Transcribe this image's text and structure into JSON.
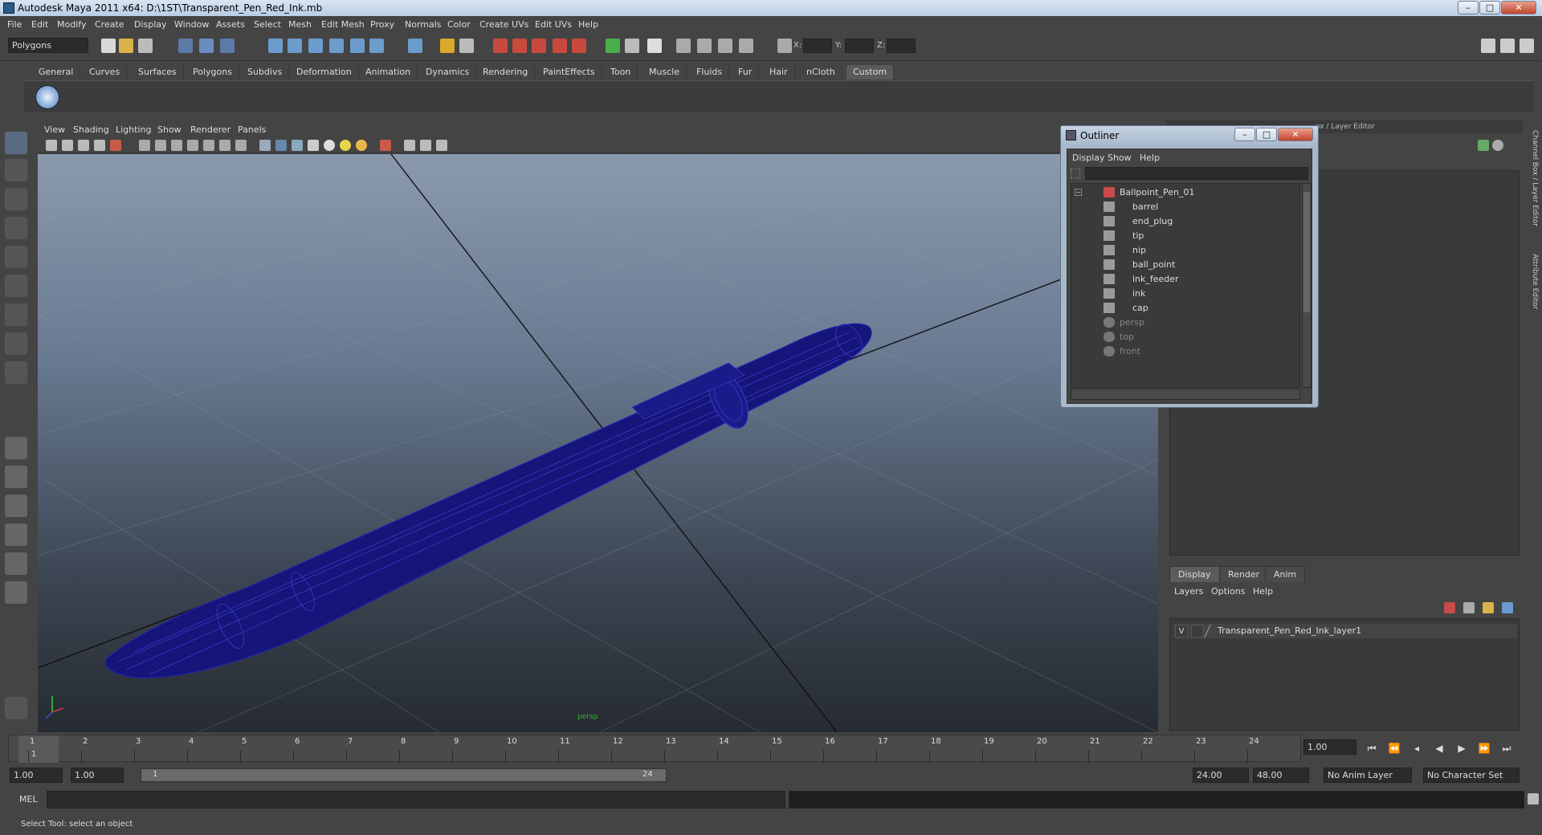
{
  "app": {
    "title": "Autodesk Maya 2011 x64: D:\\1ST\\Transparent_Pen_Red_Ink.mb",
    "win_buttons": [
      "–",
      "□",
      "✕"
    ]
  },
  "menubar": [
    "File",
    "Edit",
    "Modify",
    "Create",
    "Display",
    "Window",
    "Assets",
    "Select",
    "Mesh",
    "Edit Mesh",
    "Proxy",
    "Normals",
    "Color",
    "Create UVs",
    "Edit UVs",
    "Help"
  ],
  "toolbar": {
    "mode_select": "Polygons",
    "x_label": "X:",
    "y_label": "Y:",
    "z_label": "Z:"
  },
  "shelf": {
    "tabs": [
      "General",
      "Curves",
      "Surfaces",
      "Polygons",
      "Subdivs",
      "Deformation",
      "Animation",
      "Dynamics",
      "Rendering",
      "PaintEffects",
      "Toon",
      "Muscle",
      "Fluids",
      "Fur",
      "Hair",
      "nCloth",
      "Custom"
    ],
    "active_tab": "Custom"
  },
  "viewport": {
    "menu": [
      "View",
      "Shading",
      "Lighting",
      "Show",
      "Renderer",
      "Panels"
    ],
    "camera_label": "persp",
    "wire_color": "#1c1c8a"
  },
  "right_panel": {
    "header": "Channel Box / Layer Editor",
    "header_visible": "ox / Layer Editor",
    "side_tabs": [
      "Channel Box / Layer Editor",
      "Attribute Editor"
    ],
    "layer_tabs": [
      "Display",
      "Render",
      "Anim"
    ],
    "active_layer_tab": "Display",
    "layer_menu": [
      "Layers",
      "Options",
      "Help"
    ],
    "layers": [
      {
        "visible": "V",
        "name": "Transparent_Pen_Red_Ink_layer1"
      }
    ]
  },
  "outliner": {
    "title": "Outliner",
    "menu": [
      "Display",
      "Show",
      "Help"
    ],
    "root": "Ballpoint_Pen_01",
    "children": [
      "barrel",
      "end_plug",
      "tip",
      "nip",
      "ball_point",
      "ink_feeder",
      "ink",
      "cap"
    ],
    "cameras": [
      "persp",
      "top",
      "front"
    ]
  },
  "timeline": {
    "ticks": [
      "1",
      "2",
      "3",
      "4",
      "5",
      "6",
      "7",
      "8",
      "9",
      "10",
      "11",
      "12",
      "13",
      "14",
      "15",
      "16",
      "17",
      "18",
      "19",
      "20",
      "21",
      "22",
      "23",
      "24"
    ],
    "current_frame_marker": "1",
    "current_time": "1.00"
  },
  "range": {
    "start_time": "1.00",
    "playback_start": "1.00",
    "slider_start": "1",
    "slider_end": "24",
    "playback_end": "24.00",
    "end_time": "48.00",
    "anim_layer": "No Anim Layer",
    "character_set": "No Character Set"
  },
  "command_line": {
    "label": "MEL"
  },
  "help_line": {
    "text": "Select Tool: select an object"
  }
}
